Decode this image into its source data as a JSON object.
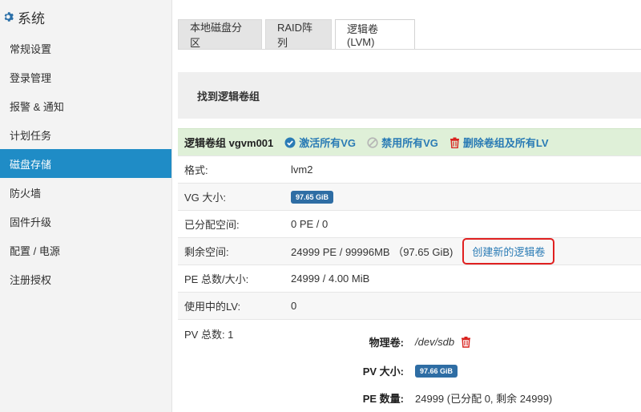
{
  "sidebar": {
    "title": "系统",
    "items": [
      {
        "label": "常规设置"
      },
      {
        "label": "登录管理"
      },
      {
        "label": "报警 & 通知"
      },
      {
        "label": "计划任务"
      },
      {
        "label": "磁盘存储",
        "active": true
      },
      {
        "label": "防火墙"
      },
      {
        "label": "固件升级"
      },
      {
        "label": "配置 / 电源"
      },
      {
        "label": "注册授权"
      }
    ]
  },
  "tabs": [
    {
      "label": "本地磁盘分区"
    },
    {
      "label": "RAID阵列"
    },
    {
      "label": "逻辑卷(LVM)",
      "active": true
    }
  ],
  "section": {
    "title": "找到逻辑卷组"
  },
  "vg": {
    "title": "逻辑卷组 vgvm001",
    "activate_all": "激活所有VG",
    "disable_all": "禁用所有VG",
    "delete_all": "删除卷组及所有LV"
  },
  "details": {
    "format_label": "格式:",
    "format_value": "lvm2",
    "vg_size_label": "VG 大小:",
    "vg_size_value": "97.65 GiB",
    "allocated_label": "已分配空间:",
    "allocated_value": "0 PE / 0",
    "free_label": "剩余空间:",
    "free_value": "24999 PE / 99996MB （97.65 GiB)",
    "create_lv": "创建新的逻辑卷",
    "pe_total_label": "PE 总数/大小:",
    "pe_total_value": "24999 / 4.00 MiB",
    "lv_in_use_label": "使用中的LV:",
    "lv_in_use_value": "0",
    "pv_total_label": "PV 总数: 1"
  },
  "pv": {
    "device_label": "物理卷:",
    "device_value": "/dev/sdb",
    "size_label": "PV 大小:",
    "size_value": "97.66 GiB",
    "pe_count_label": "PE 数量:",
    "pe_count_value": "24999 (已分配 0, 剩余 24999)"
  },
  "colors": {
    "accent": "#1f8cc6",
    "link": "#2a7bb5",
    "badge": "#2e6da4",
    "success_bg": "#dff0d8",
    "danger": "#e02020"
  }
}
